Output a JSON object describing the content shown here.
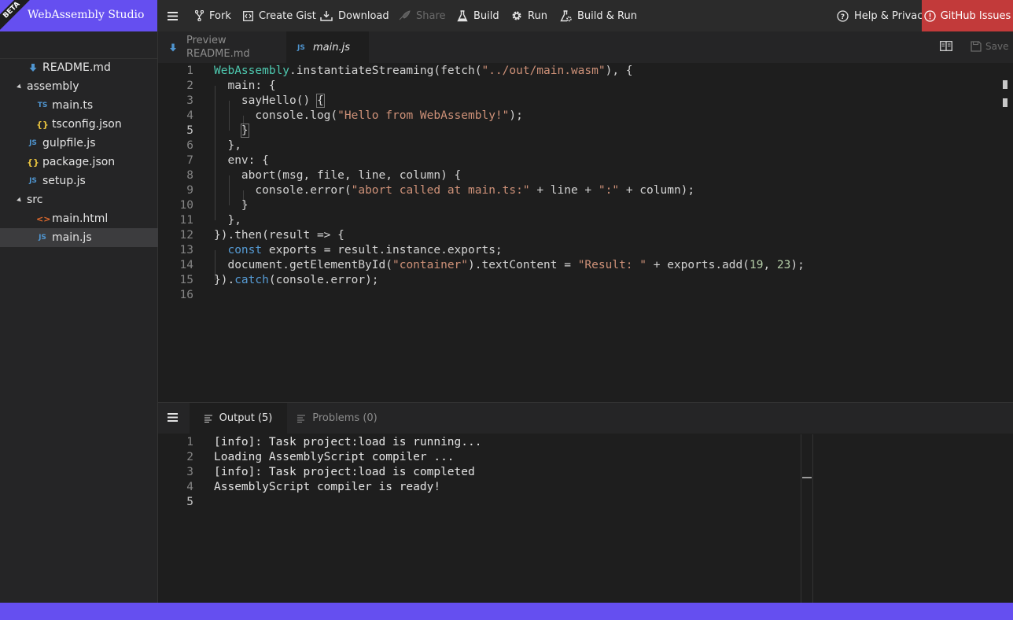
{
  "app": {
    "title": "WebAssembly Studio",
    "beta_label": "BETA"
  },
  "toolbar": {
    "fork": "Fork",
    "create_gist": "Create Gist",
    "download": "Download",
    "share": "Share",
    "build": "Build",
    "run": "Run",
    "build_run": "Build & Run",
    "help": "Help & Privacy",
    "issues": "GitHub Issues"
  },
  "sidebar": {
    "items": [
      {
        "label": "README.md",
        "icon": "markdown-icon",
        "kind": "file"
      },
      {
        "label": "assembly",
        "icon": "folder-open-caret",
        "kind": "folder"
      },
      {
        "label": "main.ts",
        "icon": "TS",
        "kind": "file"
      },
      {
        "label": "tsconfig.json",
        "icon": "{}",
        "kind": "file"
      },
      {
        "label": "gulpfile.js",
        "icon": "JS",
        "kind": "file"
      },
      {
        "label": "package.json",
        "icon": "{}",
        "kind": "file"
      },
      {
        "label": "setup.js",
        "icon": "JS",
        "kind": "file"
      },
      {
        "label": "src",
        "icon": "folder-open-caret",
        "kind": "folder"
      },
      {
        "label": "main.html",
        "icon": "<>",
        "kind": "file"
      },
      {
        "label": "main.js",
        "icon": "JS",
        "kind": "file",
        "selected": true
      }
    ]
  },
  "tabs": {
    "preview_line1": "Preview",
    "preview_line2": "README.md",
    "main_icon": "JS",
    "main": "main.js",
    "save": "Save"
  },
  "editor": {
    "line_numbers": [
      "1",
      "2",
      "3",
      "4",
      "5",
      "6",
      "7",
      "8",
      "9",
      "10",
      "11",
      "12",
      "13",
      "14",
      "15",
      "16"
    ],
    "current_line": 5
  },
  "panel": {
    "output_tab": "Output (5)",
    "problems_tab": "Problems (0)",
    "output_line_numbers": [
      "1",
      "2",
      "3",
      "4",
      "5"
    ],
    "output_lines": [
      "[info]: Task project:load is running...",
      "Loading AssemblyScript compiler ...",
      "[info]: Task project:load is completed",
      "AssemblyScript compiler is ready!",
      ""
    ]
  },
  "colors": {
    "brand": "#654ff0",
    "issues": "#c23a3a",
    "keyword": "#569cd6",
    "string": "#ce9178",
    "number": "#b5cea8",
    "type": "#4ec9b0"
  }
}
